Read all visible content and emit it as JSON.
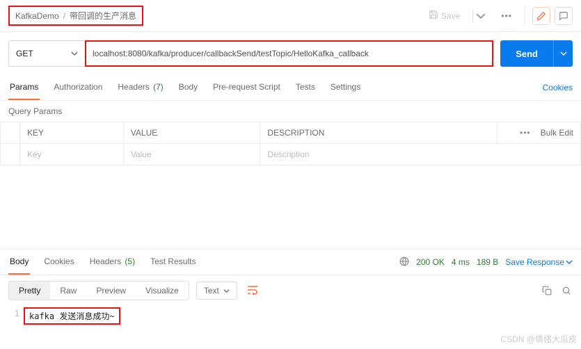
{
  "breadcrumb": {
    "collection": "KafkaDemo",
    "sep": "/",
    "item": "带回调的生产消息"
  },
  "toolbar": {
    "save": "Save"
  },
  "request": {
    "method": "GET",
    "url": "localhost:8080/kafka/producer/callbackSend/testTopic/HelloKafka_callback",
    "send": "Send"
  },
  "tabs": {
    "params": "Params",
    "auth": "Authorization",
    "headers": "Headers",
    "headers_count": "(7)",
    "body": "Body",
    "prereq": "Pre-request Script",
    "tests": "Tests",
    "settings": "Settings",
    "cookies": "Cookies"
  },
  "query_params": {
    "title": "Query Params",
    "th_key": "KEY",
    "th_value": "VALUE",
    "th_desc": "DESCRIPTION",
    "bulk": "Bulk Edit",
    "ph_key": "Key",
    "ph_value": "Value",
    "ph_desc": "Description"
  },
  "response": {
    "tabs": {
      "body": "Body",
      "cookies": "Cookies",
      "headers": "Headers",
      "headers_count": "(5)",
      "tests": "Test Results"
    },
    "status": "200 OK",
    "time": "4 ms",
    "size": "189 B",
    "save": "Save Response"
  },
  "viewer": {
    "pretty": "Pretty",
    "raw": "Raw",
    "preview": "Preview",
    "visualize": "Visualize",
    "format": "Text"
  },
  "body_content": {
    "line1_no": "1",
    "line1": "kafka 发送消息成功~"
  },
  "watermark": "CSDN @情绪大瓜皮"
}
